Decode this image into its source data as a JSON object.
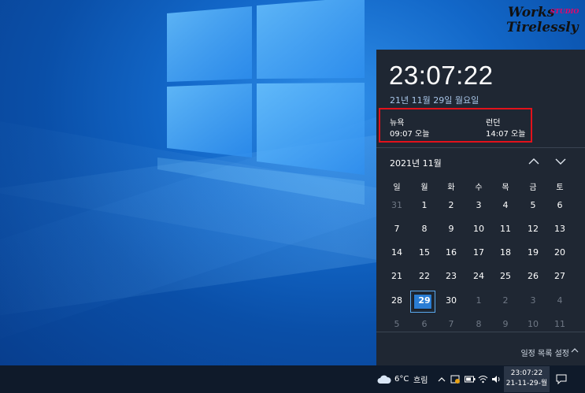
{
  "watermark": {
    "line1": "Works",
    "tag": "STUDIO",
    "line2": "Tirelessly"
  },
  "flyout": {
    "time": "23:07:22",
    "date_long": "21년 11월 29일 월요일",
    "world_clocks": [
      {
        "city": "뉴욕",
        "time": "09:07 오늘"
      },
      {
        "city": "런던",
        "time": "14:07 오늘"
      }
    ],
    "month_label": "2021년 11월",
    "weekdays": [
      "일",
      "월",
      "화",
      "수",
      "목",
      "금",
      "토"
    ],
    "weeks": [
      [
        "31",
        "1",
        "2",
        "3",
        "4",
        "5",
        "6"
      ],
      [
        "7",
        "8",
        "9",
        "10",
        "11",
        "12",
        "13"
      ],
      [
        "14",
        "15",
        "16",
        "17",
        "18",
        "19",
        "20"
      ],
      [
        "21",
        "22",
        "23",
        "24",
        "25",
        "26",
        "27"
      ],
      [
        "28",
        "29",
        "30",
        "1",
        "2",
        "3",
        "4"
      ],
      [
        "5",
        "6",
        "7",
        "8",
        "9",
        "10",
        "11"
      ]
    ],
    "selected_day": "29",
    "agenda_label": "일정 목록 설정"
  },
  "taskbar": {
    "weather_temp": "6°C",
    "weather_desc": "흐림",
    "clock_time": "23:07:22",
    "clock_date": "21-11-29-월"
  },
  "colors": {
    "flyout_bg": "#1f2733",
    "taskbar_bg": "#0f1a2a",
    "accent": "#2a7dd4",
    "highlight_box": "#e2121b"
  }
}
